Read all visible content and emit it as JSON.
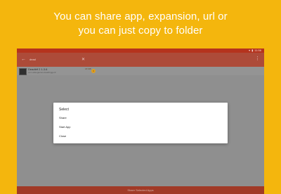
{
  "promo": {
    "line1": "You can share app, expansion, url or",
    "line2": "you can just copy to folder"
  },
  "status_bar": {
    "time": "11:56"
  },
  "toolbar": {
    "query": "dead",
    "back_icon": "arrow-back-icon",
    "clear_icon": "close-icon",
    "more_icon": "more-vert-icon"
  },
  "app_list": {
    "items": [
      {
        "name": "Deadtrif 2 1.3.6",
        "subtitle": "com.ekkogames.deadtrigger2",
        "size": "18 MB",
        "badge": "3"
      }
    ]
  },
  "dialog": {
    "title": "Select",
    "options": [
      "Share",
      "Start App",
      "Close"
    ]
  },
  "bottom_bar": {
    "label": "Share Selected Apps"
  },
  "colors": {
    "background": "#f4b60d",
    "status_bar": "#b5331d",
    "toolbar": "#ad4b39",
    "dim": "#8f8f8f",
    "bottom_bar": "#a13a27"
  }
}
